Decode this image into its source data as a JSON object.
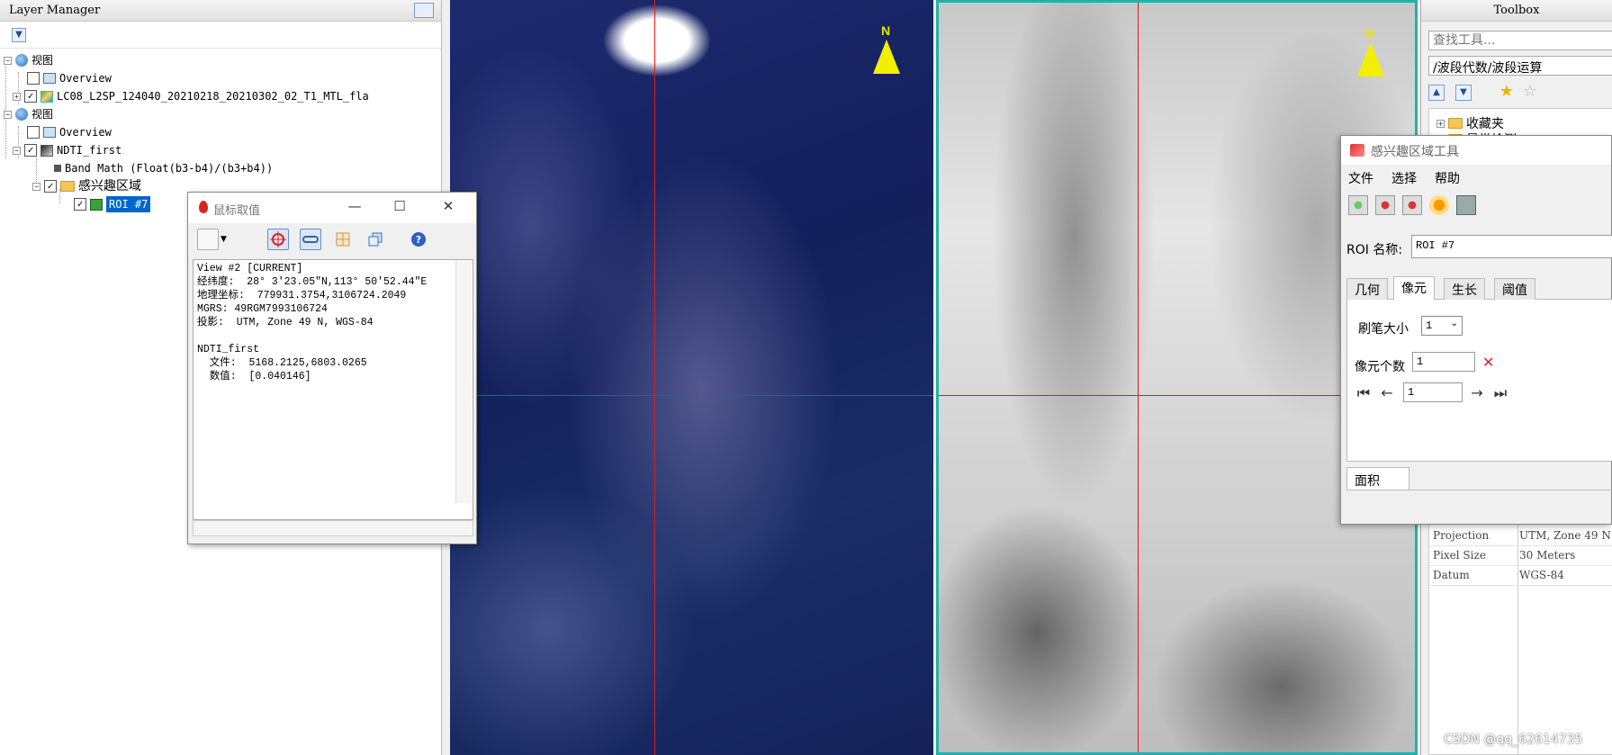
{
  "layer_manager": {
    "title": "Layer Manager",
    "tree": [
      {
        "label": "视图"
      },
      {
        "label": "Overview"
      },
      {
        "label": "LC08_L2SP_124040_20210218_20210302_02_T1_MTL_fla"
      },
      {
        "label": "视图"
      },
      {
        "label": "Overview"
      },
      {
        "label": "NDTI_first"
      },
      {
        "label": "Band Math (Float(b3-b4)/(b3+b4))"
      },
      {
        "label": "感兴趣区域"
      },
      {
        "label": "ROI #7"
      }
    ]
  },
  "cursor_value": {
    "title": "鼠标取值",
    "lines": [
      "View #2 [CURRENT]",
      "经纬度:  28° 3'23.05\"N,113° 50'52.44\"E",
      "地理坐标:  779931.3754,3106724.2049",
      "MGRS: 49RGM7993106724",
      "投影:  UTM, Zone 49 N, WGS-84",
      "",
      "NDTI_first",
      "  文件:  5168.2125,6803.0265",
      "  数值:  [0.040146]"
    ]
  },
  "views": {
    "north_label": "N"
  },
  "toolbox": {
    "title": "Toolbox",
    "search_placeholder": "查找工具...",
    "path": "/波段代数/波段运算",
    "tree": [
      {
        "label": "收藏夹"
      },
      {
        "label": "最常检测"
      }
    ],
    "properties": [
      {
        "key": "Projection",
        "value": "UTM, Zone 49 N"
      },
      {
        "key": "Pixel Size",
        "value": "30 Meters"
      },
      {
        "key": "Datum",
        "value": "WGS-84"
      }
    ]
  },
  "roi_tool": {
    "title": "感兴趣区域工具",
    "menu": [
      "文件",
      "选择",
      "帮助"
    ],
    "name_label": "ROI 名称:",
    "name_value": "ROI #7",
    "tabs": [
      "几何",
      "像元",
      "生长",
      "阈值"
    ],
    "active_tab": "像元",
    "brush_label": "刷笔大小",
    "brush_value": "1",
    "pixel_count_label": "像元个数",
    "pixel_count_value": "1",
    "nav_value": "1",
    "bottom_tab": "面积"
  },
  "watermark": "CSDN @qq_62614735",
  "colors": {
    "crosshair": "#e01b1b",
    "active_view_border": "#20b2aa",
    "selection": "#0066cc",
    "north_arrow": "#f2ef00"
  }
}
